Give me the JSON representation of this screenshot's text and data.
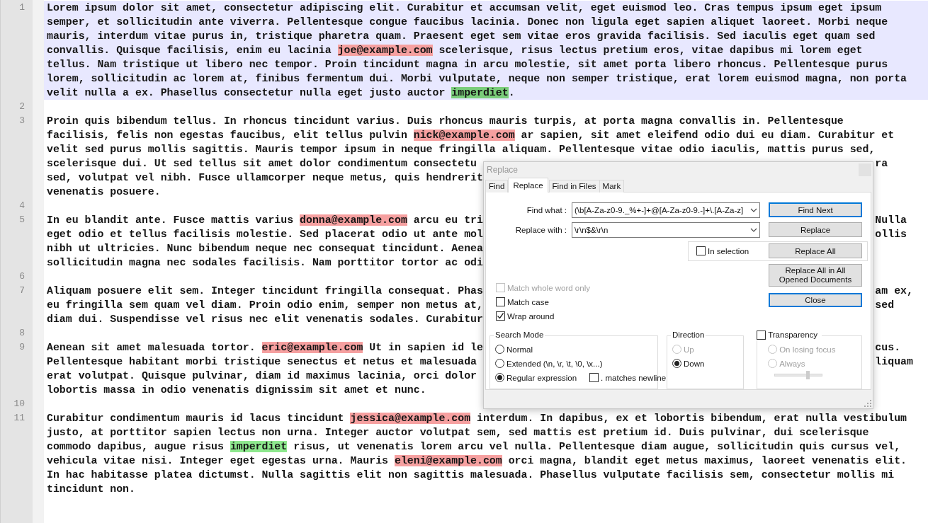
{
  "editor": {
    "lines": [
      {
        "number": "1",
        "current": true,
        "rows": [
          {
            "parts": [
              {
                "kind": "text",
                "text": "Lorem ipsum dolor sit amet, consectetur adipiscing elit. Curabitur et accumsan velit, eget euismod leo. Cras tempus ipsum eget ipsum"
              }
            ]
          },
          {
            "parts": [
              {
                "kind": "text",
                "text": "semper, et sollicitudin ante viverra. Pellentesque congue faucibus lacinia. Donec non ligula eget sapien aliquet laoreet. Morbi neque"
              }
            ]
          },
          {
            "parts": [
              {
                "kind": "text",
                "text": "mauris, interdum vitae purus in, tristique pharetra quam. Praesent eget sem vitae eros gravida facilisis. Sed iaculis eget quam sed"
              }
            ]
          },
          {
            "parts": [
              {
                "kind": "text",
                "text": "convallis. Quisque facilisis, enim eu lacinia "
              },
              {
                "kind": "email",
                "text": "joe@example.com"
              },
              {
                "kind": "text",
                "text": " scelerisque, risus lectus pretium eros, vitae dapibus mi lorem eget"
              }
            ]
          },
          {
            "parts": [
              {
                "kind": "text",
                "text": "tellus. Nam tristique ut libero nec tempor. Proin tincidunt magna in arcu molestie, sit amet porta libero rhoncus. Pellentesque purus"
              }
            ]
          },
          {
            "parts": [
              {
                "kind": "text",
                "text": "lorem, sollicitudin ac lorem at, finibus fermentum dui. Morbi vulputate, neque non semper tristique, erat lorem euismod magna, non porta"
              }
            ]
          },
          {
            "parts": [
              {
                "kind": "text",
                "text": "velit nulla a ex. Phasellus consectetur nulla eget justo auctor "
              },
              {
                "kind": "match",
                "text": "imperdiet"
              },
              {
                "kind": "text",
                "text": "."
              }
            ]
          }
        ]
      },
      {
        "number": "2",
        "current": false
      },
      {
        "number": "3",
        "current": false,
        "rows": [
          {
            "parts": [
              {
                "kind": "text",
                "text": "Proin quis bibendum tellus. In rhoncus tincidunt varius. Duis rhoncus mauris turpis, at porta magna convallis in. Pellentesque"
              }
            ]
          },
          {
            "parts": [
              {
                "kind": "text",
                "text": "facilisis, felis non egestas faucibus, elit tellus pulvin "
              },
              {
                "kind": "email",
                "text": "nick@example.com"
              },
              {
                "kind": "text",
                "text": " ar sapien, sit amet eleifend odio dui eu diam. Curabitur et"
              }
            ]
          },
          {
            "parts": [
              {
                "kind": "text",
                "text": "velit sed purus mollis sagittis. Mauris tempor ipsum in neque fringilla aliquam. Pellentesque vitae odio iaculis, mattis purus sed,"
              }
            ]
          },
          {
            "parts": [
              {
                "kind": "text",
                "text": "scelerisque dui. Ut sed tellus sit amet dolor condimentum consectetu"
              }
            ],
            "right": "ra"
          },
          {
            "parts": [
              {
                "kind": "text",
                "text": "sed, volutpat vel nibh. Fusce ullamcorper neque metus, quis hendrerit"
              }
            ]
          },
          {
            "parts": [
              {
                "kind": "text",
                "text": "venenatis posuere."
              }
            ]
          }
        ]
      },
      {
        "number": "4",
        "current": false
      },
      {
        "number": "5",
        "current": false,
        "rows": [
          {
            "parts": [
              {
                "kind": "text",
                "text": "In eu blandit ante. Fusce mattis varius "
              },
              {
                "kind": "email",
                "text": "donna@example.com"
              },
              {
                "kind": "text",
                "text": " arcu eu tri"
              }
            ],
            "right": "Nulla"
          },
          {
            "parts": [
              {
                "kind": "text",
                "text": "eget odio et tellus facilisis molestie. Sed placerat odio ut ante mol"
              }
            ],
            "right": "ollis"
          },
          {
            "parts": [
              {
                "kind": "text",
                "text": "nibh ut ultricies. Nunc bibendum neque nec consequat tincidunt. Aenea"
              }
            ]
          },
          {
            "parts": [
              {
                "kind": "text",
                "text": "sollicitudin magna nec sodales facilisis. Nam porttitor tortor ac odi"
              }
            ]
          }
        ]
      },
      {
        "number": "6",
        "current": false
      },
      {
        "number": "7",
        "current": false,
        "rows": [
          {
            "parts": [
              {
                "kind": "text",
                "text": "Aliquam posuere elit sem. Integer tincidunt fringilla consequat. Phas"
              }
            ],
            "right": "am ex,"
          },
          {
            "parts": [
              {
                "kind": "text",
                "text": "eu fringilla sem quam vel diam. Proin odio enim, semper non metus at,"
              }
            ],
            "right": "sed"
          },
          {
            "parts": [
              {
                "kind": "text",
                "text": "diam dui. Suspendisse vel risus nec elit venenatis sodales. Curabitur"
              }
            ]
          }
        ]
      },
      {
        "number": "8",
        "current": false
      },
      {
        "number": "9",
        "current": false,
        "rows": [
          {
            "parts": [
              {
                "kind": "text",
                "text": "Aenean sit amet malesuada tortor. "
              },
              {
                "kind": "email",
                "text": "eric@example.com"
              },
              {
                "kind": "text",
                "text": " Ut in sapien id le"
              }
            ],
            "right": "cus."
          },
          {
            "parts": [
              {
                "kind": "text",
                "text": "Pellentesque habitant morbi tristique senectus et netus et malesuada"
              }
            ],
            "right": "liquam"
          },
          {
            "parts": [
              {
                "kind": "text",
                "text": "erat volutpat. Quisque pulvinar, diam id maximus lacinia, orci dolor"
              }
            ]
          },
          {
            "parts": [
              {
                "kind": "text",
                "text": "lobortis massa in odio venenatis dignissim sit amet et nunc."
              }
            ]
          }
        ]
      },
      {
        "number": "10",
        "current": false
      },
      {
        "number": "11",
        "current": false,
        "rows": [
          {
            "parts": [
              {
                "kind": "text",
                "text": "Curabitur condimentum mauris id lacus tincidunt "
              },
              {
                "kind": "email",
                "text": "jessica@example.com"
              },
              {
                "kind": "text",
                "text": " interdum. In dapibus, ex et lobortis bibendum, erat nulla vestibulum"
              }
            ]
          },
          {
            "parts": [
              {
                "kind": "text",
                "text": "justo, at porttitor sapien lectus non urna. Integer auctor volutpat sem, sed mattis est pretium id. Duis pulvinar, dui scelerisque"
              }
            ]
          },
          {
            "parts": [
              {
                "kind": "text",
                "text": "commodo dapibus, augue risus "
              },
              {
                "kind": "match",
                "text": "imperdiet"
              },
              {
                "kind": "text",
                "text": " risus, ut venenatis lorem arcu vel nulla. Pellentesque diam augue, sollicitudin quis cursus vel,"
              }
            ]
          },
          {
            "parts": [
              {
                "kind": "text",
                "text": "vehicula vitae nisi. Integer eget egestas urna. Mauris "
              },
              {
                "kind": "email",
                "text": "eleni@example.com"
              },
              {
                "kind": "text",
                "text": " orci magna, blandit eget metus maximus, laoreet venenatis elit."
              }
            ]
          },
          {
            "parts": [
              {
                "kind": "text",
                "text": "In hac habitasse platea dictumst. Nulla sagittis elit non sagittis malesuada. Phasellus vulputate facilisis sem, consectetur mollis mi"
              }
            ]
          },
          {
            "parts": [
              {
                "kind": "text",
                "text": "tincidunt non."
              }
            ]
          }
        ]
      }
    ]
  },
  "dialog": {
    "title": "Replace",
    "tabs": [
      {
        "label": "Find",
        "selected": false
      },
      {
        "label": "Replace",
        "selected": true
      },
      {
        "label": "Find in Files",
        "selected": false
      },
      {
        "label": "Mark",
        "selected": false
      }
    ],
    "find_what": {
      "label": "Find what :",
      "value": "(\\b[A-Za-z0-9._%+-]+@[A-Za-z0-9.-]+\\.[A-Za-z]"
    },
    "replace_with": {
      "label": "Replace with :",
      "value": "\\r\\n$&\\r\\n"
    },
    "buttons": [
      {
        "label": "Find Next",
        "default": true
      },
      {
        "label": "Replace",
        "default": false
      },
      {
        "label": "Replace All",
        "default": false
      },
      {
        "label": "Replace All in All Opened Documents",
        "default": false
      },
      {
        "label": "Close",
        "default": true
      }
    ],
    "in_selection": {
      "label": "In selection",
      "checked": false
    },
    "options": [
      {
        "label": "Match whole word only",
        "checked": false,
        "disabled": true
      },
      {
        "label": "Match case",
        "checked": false,
        "disabled": false
      },
      {
        "label": "Wrap around",
        "checked": true,
        "disabled": false
      }
    ],
    "search_mode": {
      "title": "Search Mode",
      "options": [
        {
          "label": "Normal",
          "selected": false
        },
        {
          "label": "Extended (\\n, \\r, \\t, \\0, \\x...)",
          "selected": false
        },
        {
          "label": "Regular expression",
          "selected": true
        }
      ],
      "dot_newline": {
        "label": ". matches newline",
        "checked": false
      }
    },
    "direction": {
      "title": "Direction",
      "options": [
        {
          "label": "Up",
          "selected": false,
          "disabled": true
        },
        {
          "label": "Down",
          "selected": true,
          "disabled": false
        }
      ]
    },
    "transparency": {
      "label": "Transparency",
      "checked": false,
      "options": [
        {
          "label": "On losing focus",
          "selected": false
        },
        {
          "label": "Always",
          "selected": false
        }
      ],
      "slider": {
        "level": 0.7
      }
    }
  }
}
